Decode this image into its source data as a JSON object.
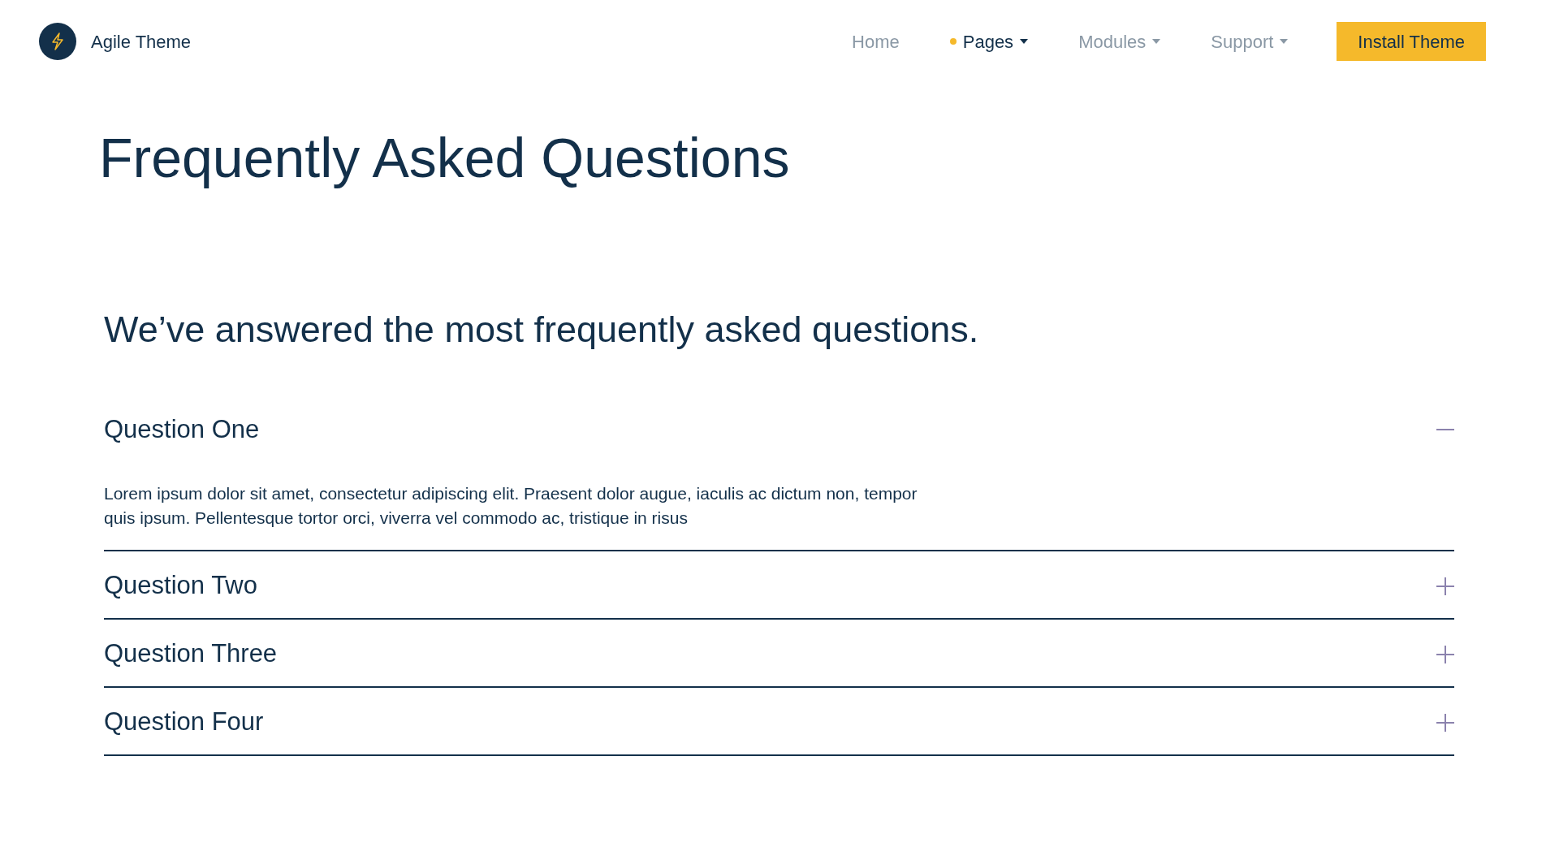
{
  "brand": {
    "name": "Agile Theme"
  },
  "nav": [
    {
      "label": "Home",
      "selected": false,
      "has_menu": false
    },
    {
      "label": "Pages",
      "selected": true,
      "has_menu": true
    },
    {
      "label": "Modules",
      "selected": false,
      "has_menu": true
    },
    {
      "label": "Support",
      "selected": false,
      "has_menu": true
    }
  ],
  "cta": "Install Theme",
  "title": "Frequently Asked Questions",
  "subtitle": "We’ve answered the most frequently asked questions.",
  "faq": [
    {
      "question": "Question One",
      "expanded": true,
      "answer": "Lorem ipsum dolor sit amet, consectetur adipiscing elit. Praesent dolor augue, iaculis ac dictum non, tempor quis ipsum. Pellentesque tortor orci, viverra vel commodo ac, tristique in risus"
    },
    {
      "question": "Question Two",
      "expanded": false
    },
    {
      "question": "Question Three",
      "expanded": false
    },
    {
      "question": "Question Four",
      "expanded": false
    }
  ]
}
